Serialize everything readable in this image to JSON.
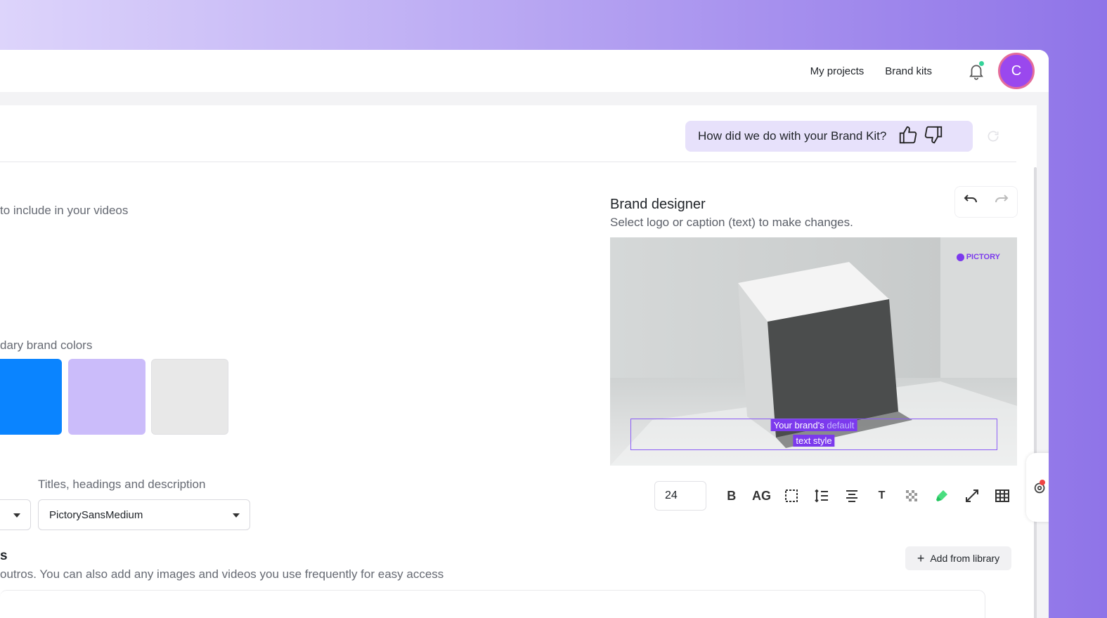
{
  "topnav": {
    "my_projects": "My projects",
    "brand_kits": "Brand kits",
    "avatar_initial": "C"
  },
  "feedback": {
    "prompt": "How did we do with your Brand Kit?"
  },
  "brand": {
    "logo_subtitle": "to include in your videos",
    "colors_label": "dary brand colors",
    "colors": [
      "#0a84ff",
      "#cbbcfa",
      "#e8e8e8"
    ],
    "fonts": {
      "titles_label": "Titles, headings and description",
      "selected_font": "PictorySansMedium"
    },
    "assets": {
      "heading": "s",
      "description": "outros. You can also add any images and videos you use frequently for easy access",
      "add_button": "Add from library"
    }
  },
  "designer": {
    "title": "Brand designer",
    "subtitle": "Select logo or caption (text) to make changes.",
    "canvas_logo": "PICTORY",
    "caption_line1_a": "Your brand's",
    "caption_line1_b": "default",
    "caption_line2": "text style",
    "font_size": "24",
    "toolbar": {
      "bold": "B",
      "case": "AG",
      "text_t": "T"
    }
  }
}
